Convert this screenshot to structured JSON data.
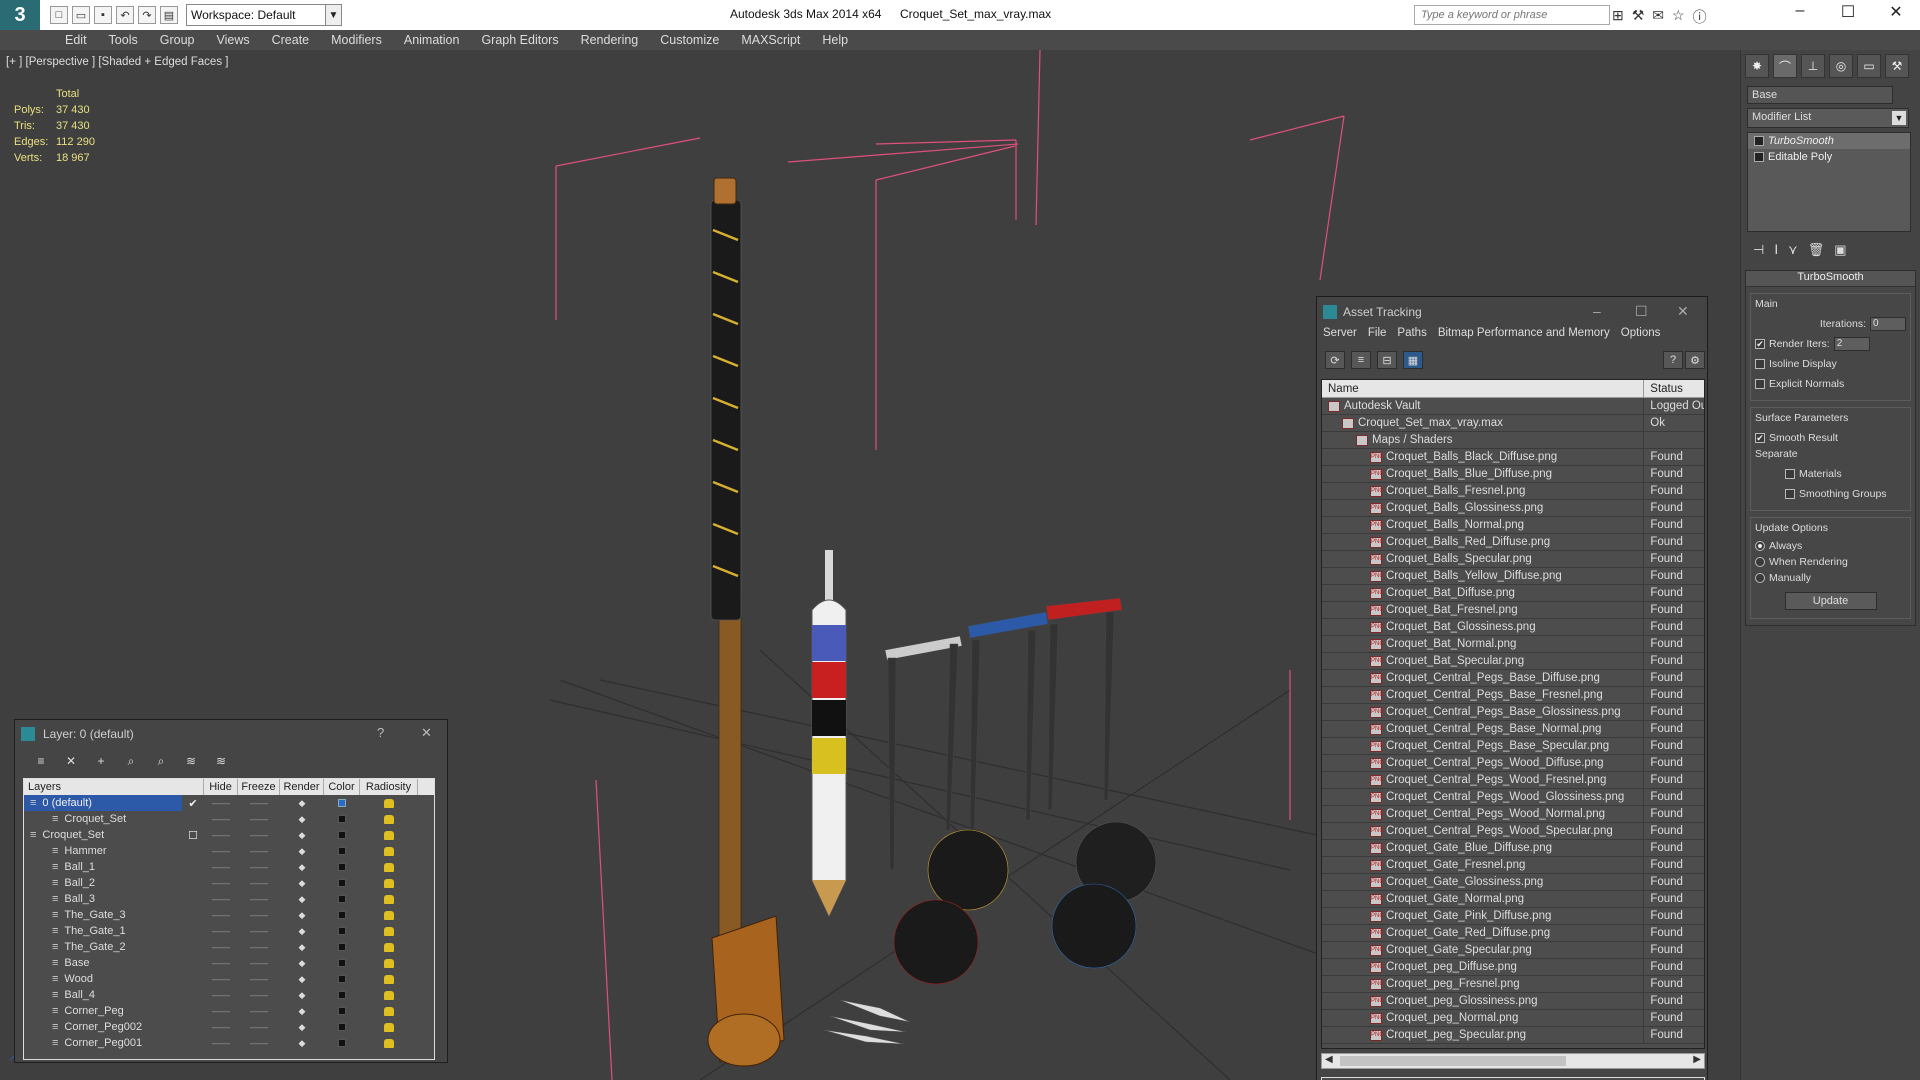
{
  "titlebar": {
    "app_title": "Autodesk 3ds Max  2014 x64",
    "file_title": "Croquet_Set_max_vray.max",
    "workspace": "Workspace: Default",
    "search_placeholder": "Type a keyword or phrase",
    "logo": "3"
  },
  "menu": [
    "Edit",
    "Tools",
    "Group",
    "Views",
    "Create",
    "Modifiers",
    "Animation",
    "Graph Editors",
    "Rendering",
    "Customize",
    "MAXScript",
    "Help"
  ],
  "viewport": {
    "label": "[+ ] [Perspective ] [Shaded + Edged Faces ]",
    "stats": {
      "header": "Total",
      "polys_label": "Polys:",
      "polys": "37 430",
      "tris_label": "Tris:",
      "tris": "37 430",
      "edges_label": "Edges:",
      "edges": "112 290",
      "verts_label": "Verts:",
      "verts": "18 967"
    }
  },
  "command_panel": {
    "object_name": "Base",
    "modifier_list": "Modifier List",
    "stack": [
      "TurboSmooth",
      "Editable Poly"
    ],
    "rollout_title": "TurboSmooth",
    "main_group": "Main",
    "iterations_label": "Iterations:",
    "iterations": "0",
    "render_iters_label": "Render Iters:",
    "render_iters": "2",
    "isoline": "Isoline Display",
    "explicit_normals": "Explicit Normals",
    "surface_params": "Surface Parameters",
    "smooth_result": "Smooth Result",
    "separate": "Separate",
    "materials": "Materials",
    "smoothing_groups": "Smoothing Groups",
    "update_options": "Update Options",
    "always": "Always",
    "when_rendering": "When Rendering",
    "manually": "Manually",
    "update_button": "Update"
  },
  "asset_tracking": {
    "title": "Asset Tracking",
    "menu": [
      "Server",
      "File",
      "Paths",
      "Bitmap Performance and Memory",
      "Options"
    ],
    "col_name": "Name",
    "col_status": "Status",
    "rows": [
      {
        "name": "Autodesk Vault",
        "status": "Logged Ou",
        "icon": "vault",
        "indent": 0
      },
      {
        "name": "Croquet_Set_max_vray.max",
        "status": "Ok",
        "icon": "max",
        "indent": 1
      },
      {
        "name": "Maps / Shaders",
        "status": "",
        "icon": "folder",
        "indent": 2
      },
      {
        "name": "Croquet_Balls_Black_Diffuse.png",
        "status": "Found",
        "icon": "png",
        "indent": 3
      },
      {
        "name": "Croquet_Balls_Blue_Diffuse.png",
        "status": "Found",
        "icon": "png",
        "indent": 3
      },
      {
        "name": "Croquet_Balls_Fresnel.png",
        "status": "Found",
        "icon": "png",
        "indent": 3
      },
      {
        "name": "Croquet_Balls_Glossiness.png",
        "status": "Found",
        "icon": "png",
        "indent": 3
      },
      {
        "name": "Croquet_Balls_Normal.png",
        "status": "Found",
        "icon": "png",
        "indent": 3
      },
      {
        "name": "Croquet_Balls_Red_Diffuse.png",
        "status": "Found",
        "icon": "png",
        "indent": 3
      },
      {
        "name": "Croquet_Balls_Specular.png",
        "status": "Found",
        "icon": "png",
        "indent": 3
      },
      {
        "name": "Croquet_Balls_Yellow_Diffuse.png",
        "status": "Found",
        "icon": "png",
        "indent": 3
      },
      {
        "name": "Croquet_Bat_Diffuse.png",
        "status": "Found",
        "icon": "png",
        "indent": 3
      },
      {
        "name": "Croquet_Bat_Fresnel.png",
        "status": "Found",
        "icon": "png",
        "indent": 3
      },
      {
        "name": "Croquet_Bat_Glossiness.png",
        "status": "Found",
        "icon": "png",
        "indent": 3
      },
      {
        "name": "Croquet_Bat_Normal.png",
        "status": "Found",
        "icon": "png",
        "indent": 3
      },
      {
        "name": "Croquet_Bat_Specular.png",
        "status": "Found",
        "icon": "png",
        "indent": 3
      },
      {
        "name": "Croquet_Central_Pegs_Base_Diffuse.png",
        "status": "Found",
        "icon": "png",
        "indent": 3
      },
      {
        "name": "Croquet_Central_Pegs_Base_Fresnel.png",
        "status": "Found",
        "icon": "png",
        "indent": 3
      },
      {
        "name": "Croquet_Central_Pegs_Base_Glossiness.png",
        "status": "Found",
        "icon": "png",
        "indent": 3
      },
      {
        "name": "Croquet_Central_Pegs_Base_Normal.png",
        "status": "Found",
        "icon": "png",
        "indent": 3
      },
      {
        "name": "Croquet_Central_Pegs_Base_Specular.png",
        "status": "Found",
        "icon": "png",
        "indent": 3
      },
      {
        "name": "Croquet_Central_Pegs_Wood_Diffuse.png",
        "status": "Found",
        "icon": "png",
        "indent": 3
      },
      {
        "name": "Croquet_Central_Pegs_Wood_Fresnel.png",
        "status": "Found",
        "icon": "png",
        "indent": 3
      },
      {
        "name": "Croquet_Central_Pegs_Wood_Glossiness.png",
        "status": "Found",
        "icon": "png",
        "indent": 3
      },
      {
        "name": "Croquet_Central_Pegs_Wood_Normal.png",
        "status": "Found",
        "icon": "png",
        "indent": 3
      },
      {
        "name": "Croquet_Central_Pegs_Wood_Specular.png",
        "status": "Found",
        "icon": "png",
        "indent": 3
      },
      {
        "name": "Croquet_Gate_Blue_Diffuse.png",
        "status": "Found",
        "icon": "png",
        "indent": 3
      },
      {
        "name": "Croquet_Gate_Fresnel.png",
        "status": "Found",
        "icon": "png",
        "indent": 3
      },
      {
        "name": "Croquet_Gate_Glossiness.png",
        "status": "Found",
        "icon": "png",
        "indent": 3
      },
      {
        "name": "Croquet_Gate_Normal.png",
        "status": "Found",
        "icon": "png",
        "indent": 3
      },
      {
        "name": "Croquet_Gate_Pink_Diffuse.png",
        "status": "Found",
        "icon": "png",
        "indent": 3
      },
      {
        "name": "Croquet_Gate_Red_Diffuse.png",
        "status": "Found",
        "icon": "png",
        "indent": 3
      },
      {
        "name": "Croquet_Gate_Specular.png",
        "status": "Found",
        "icon": "png",
        "indent": 3
      },
      {
        "name": "Croquet_peg_Diffuse.png",
        "status": "Found",
        "icon": "png",
        "indent": 3
      },
      {
        "name": "Croquet_peg_Fresnel.png",
        "status": "Found",
        "icon": "png",
        "indent": 3
      },
      {
        "name": "Croquet_peg_Glossiness.png",
        "status": "Found",
        "icon": "png",
        "indent": 3
      },
      {
        "name": "Croquet_peg_Normal.png",
        "status": "Found",
        "icon": "png",
        "indent": 3
      },
      {
        "name": "Croquet_peg_Specular.png",
        "status": "Found",
        "icon": "png",
        "indent": 3
      }
    ]
  },
  "layer_window": {
    "title": "Layer: 0 (default)",
    "help": "?",
    "columns": [
      "Layers",
      "Hide",
      "Freeze",
      "Render",
      "Color",
      "Radiosity"
    ],
    "rows": [
      {
        "name": "0 (default)",
        "indent": 0,
        "selected": true,
        "color": "blue",
        "check": "✔"
      },
      {
        "name": "Croquet_Set",
        "indent": 1,
        "selected": false,
        "color": "black",
        "check": ""
      },
      {
        "name": "Croquet_Set",
        "indent": 0,
        "selected": false,
        "color": "black",
        "check": "☐"
      },
      {
        "name": "Hammer",
        "indent": 1,
        "selected": false,
        "color": "black",
        "check": ""
      },
      {
        "name": "Ball_1",
        "indent": 1,
        "selected": false,
        "color": "black",
        "check": ""
      },
      {
        "name": "Ball_2",
        "indent": 1,
        "selected": false,
        "color": "black",
        "check": ""
      },
      {
        "name": "Ball_3",
        "indent": 1,
        "selected": false,
        "color": "black",
        "check": ""
      },
      {
        "name": "The_Gate_3",
        "indent": 1,
        "selected": false,
        "color": "black",
        "check": ""
      },
      {
        "name": "The_Gate_1",
        "indent": 1,
        "selected": false,
        "color": "black",
        "check": ""
      },
      {
        "name": "The_Gate_2",
        "indent": 1,
        "selected": false,
        "color": "black",
        "check": ""
      },
      {
        "name": "Base",
        "indent": 1,
        "selected": false,
        "color": "black",
        "check": ""
      },
      {
        "name": "Wood",
        "indent": 1,
        "selected": false,
        "color": "black",
        "check": ""
      },
      {
        "name": "Ball_4",
        "indent": 1,
        "selected": false,
        "color": "black",
        "check": ""
      },
      {
        "name": "Corner_Peg",
        "indent": 1,
        "selected": false,
        "color": "black",
        "check": ""
      },
      {
        "name": "Corner_Peg002",
        "indent": 1,
        "selected": false,
        "color": "black",
        "check": ""
      },
      {
        "name": "Corner_Peg001",
        "indent": 1,
        "selected": false,
        "color": "black",
        "check": ""
      }
    ]
  },
  "colors": {
    "accent": "#2d5aa8",
    "viewport_bg": "#3f3f3f",
    "stats": "#e8e080",
    "bbox": "#e0507a"
  }
}
